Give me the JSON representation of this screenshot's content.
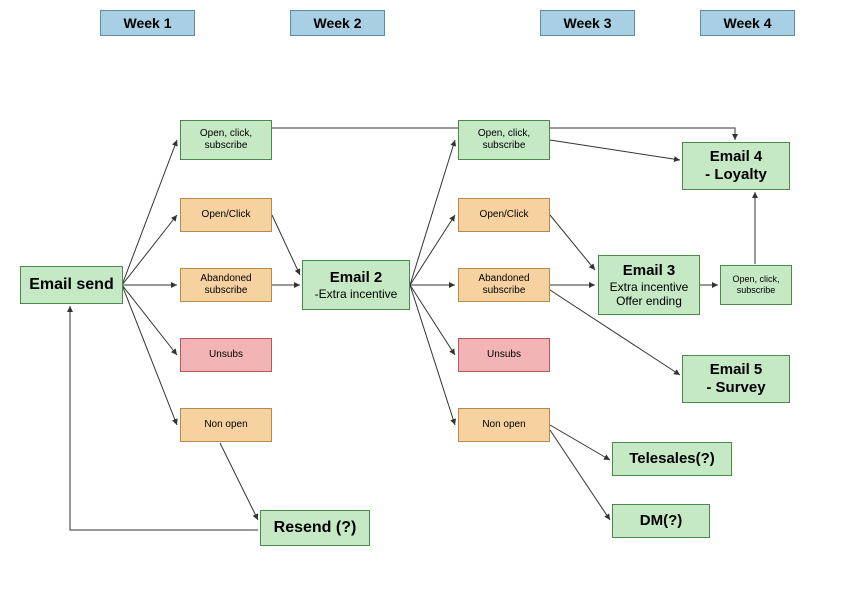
{
  "headers": {
    "w1": "Week 1",
    "w2": "Week 2",
    "w3": "Week 3",
    "w4": "Week 4"
  },
  "nodes": {
    "email_send": "Email send",
    "resend": "Resend (?)",
    "email2_l1": "Email 2",
    "email2_l2": "-Extra incentive",
    "email3_l1": "Email 3",
    "email3_l2": "Extra incentive",
    "email3_l3": "Offer ending",
    "email4_l1": "Email 4",
    "email4_l2": "- Loyalty",
    "email5_l1": "Email 5",
    "email5_l2": "- Survey",
    "telesales": "Telesales(?)",
    "dm": "DM(?)",
    "ocs": "Open, click, subscribe",
    "openclick": "Open/Click",
    "abandoned": "Abandoned subscribe",
    "unsubs": "Unsubs",
    "nonopen": "Non open"
  }
}
